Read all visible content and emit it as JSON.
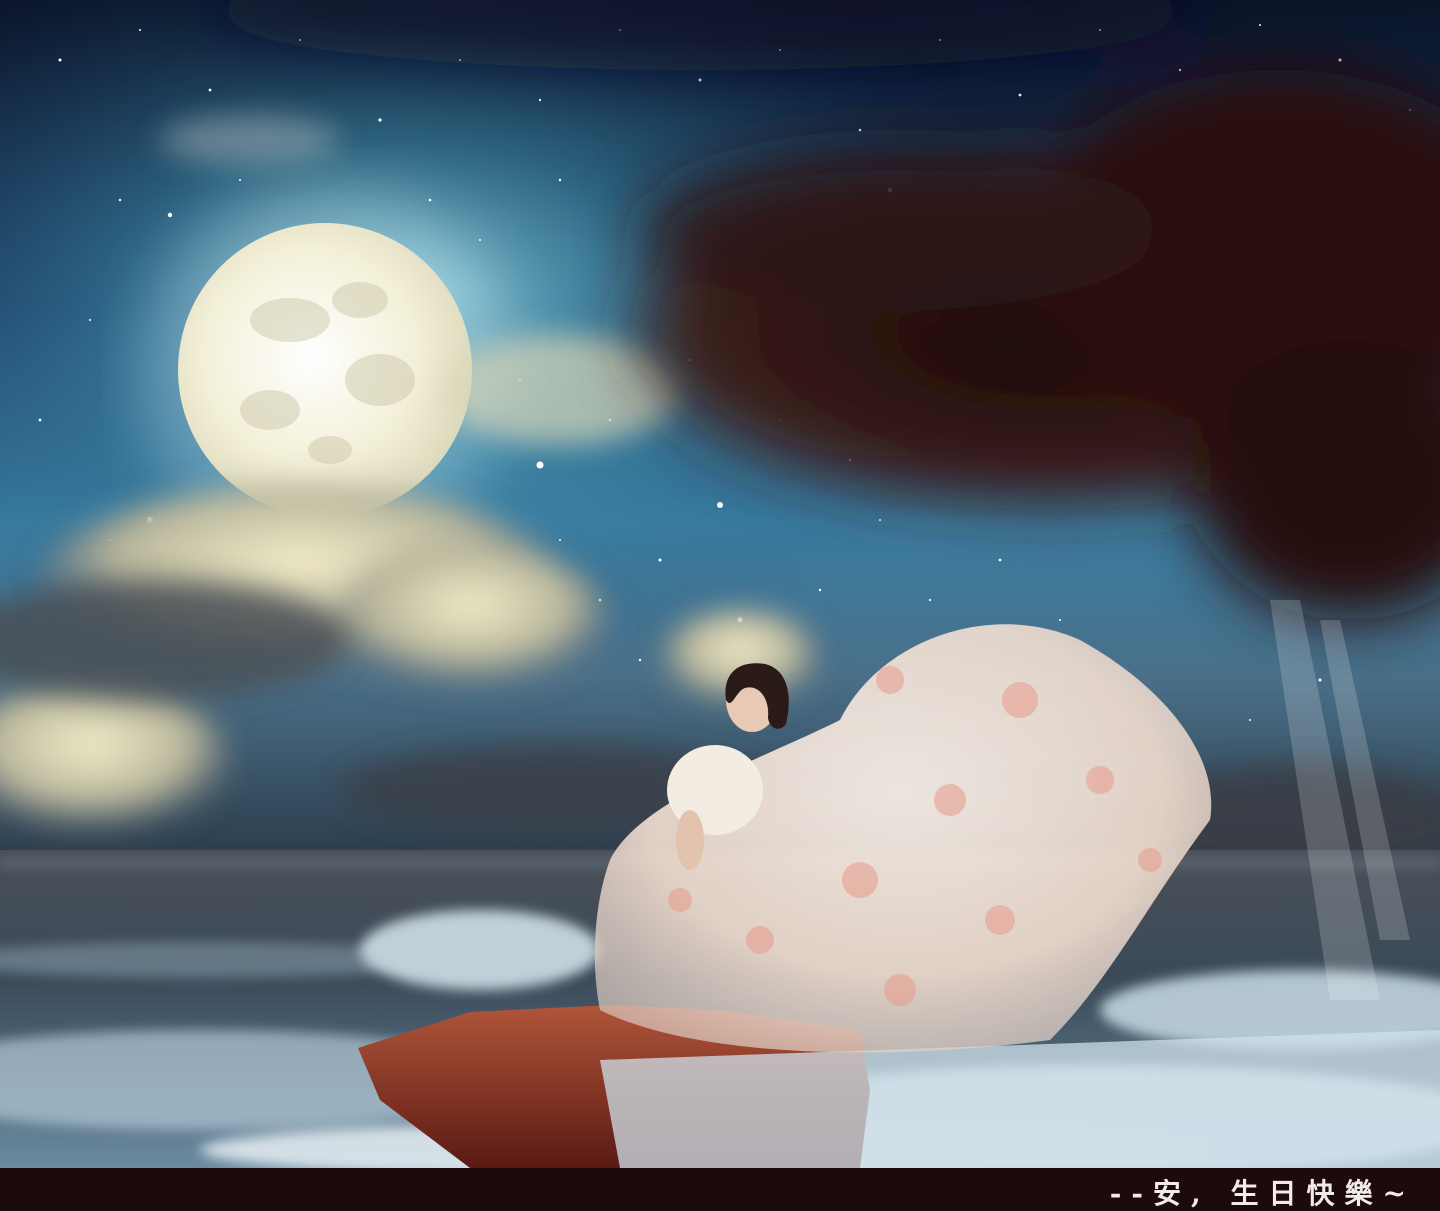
{
  "caption": {
    "text": "--安, 生日快樂~"
  },
  "colors": {
    "sky_top": "#0d1a33",
    "sky_mid": "#2d5d86",
    "sky_glow": "#5fb3c9",
    "moon": "#f4f1dc",
    "dark_cloud": "#2a1414",
    "sea": "#3e4a55",
    "rock": "#7a2a1c",
    "dress": "#efe2d6",
    "caption_bar": "#1c0a0d",
    "caption_text": "#f2ece6"
  }
}
